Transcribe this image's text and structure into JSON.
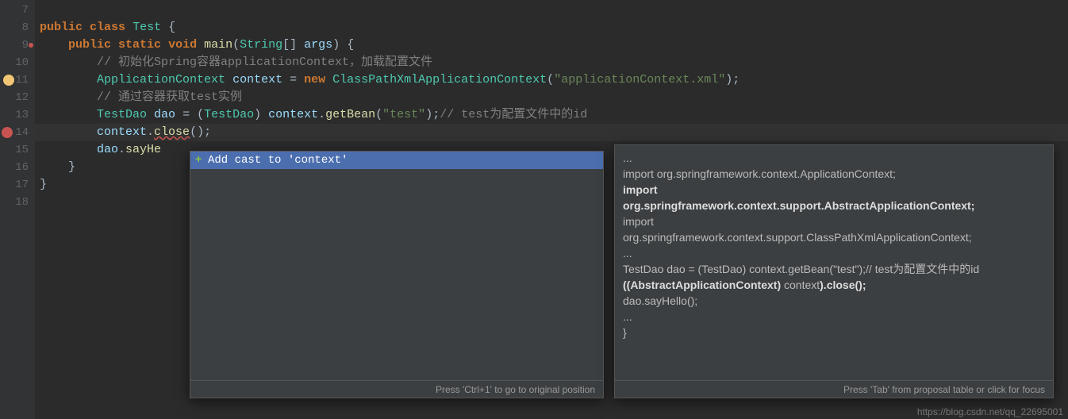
{
  "gutter": {
    "lines": [
      "7",
      "8",
      "9",
      "10",
      "11",
      "12",
      "13",
      "14",
      "15",
      "16",
      "17",
      "18"
    ],
    "markers": {
      "9_bp": true,
      "11_warn": true,
      "14_err": true
    }
  },
  "code": {
    "l7": "",
    "l8_kw1": "public",
    "l8_kw2": "class",
    "l8_cls": "Test",
    "l8_p": " {",
    "l9_kw1": "public",
    "l9_kw2": "static",
    "l9_kw3": "void",
    "l9_meth": "main",
    "l9_p1": "(",
    "l9_cls": "String",
    "l9_p2": "[] ",
    "l9_id": "args",
    "l9_p3": ") {",
    "l10_cmt": "// 初始化Spring容器applicationContext，加载配置文件",
    "l11_cls1": "ApplicationContext",
    "l11_id": "context",
    "l11_eq": " = ",
    "l11_kw": "new",
    "l11_cls2": "ClassPathXmlApplicationContext",
    "l11_p1": "(",
    "l11_str": "\"applicationContext.xml\"",
    "l11_p2": ");",
    "l12_cmt": "// 通过容器获取test实例",
    "l13_cls1": "TestDao",
    "l13_id1": "dao",
    "l13_eq": " = (",
    "l13_cls2": "TestDao",
    "l13_p1": ") ",
    "l13_id2": "context",
    "l13_p2": ".",
    "l13_meth": "getBean",
    "l13_p3": "(",
    "l13_str": "\"test\"",
    "l13_p4": ");",
    "l13_cmt": "// test为配置文件中的id",
    "l14_id": "context",
    "l14_p1": ".",
    "l14_meth": "close",
    "l14_p2": "();",
    "l15_id": "dao",
    "l15_p1": ".",
    "l15_meth": "sayHe",
    "l16_p": "}",
    "l17_p": "}"
  },
  "suggest": {
    "item1": "Add cast to 'context'",
    "footer": "Press 'Ctrl+1' to go to original position"
  },
  "doc": {
    "l1": "...",
    "l2": "import org.springframework.context.ApplicationContext;",
    "l3": "import",
    "l4": " org.springframework.context.support.AbstractApplicationContext;",
    "l5": "import",
    "l6": " org.springframework.context.support.ClassPathXmlApplicationContext;",
    "l7": "...",
    "l8": "TestDao dao = (TestDao) context.getBean(\"test\");// test为配置文件中的id",
    "l9p1": "((AbstractApplicationContext) ",
    "l9p2": "context",
    "l9p3": ").close();",
    "l10": "dao.sayHello();",
    "l11": "...",
    "l12": "}",
    "footer": "Press 'Tab' from proposal table or click for focus"
  },
  "watermark": "https://blog.csdn.net/qq_22695001"
}
